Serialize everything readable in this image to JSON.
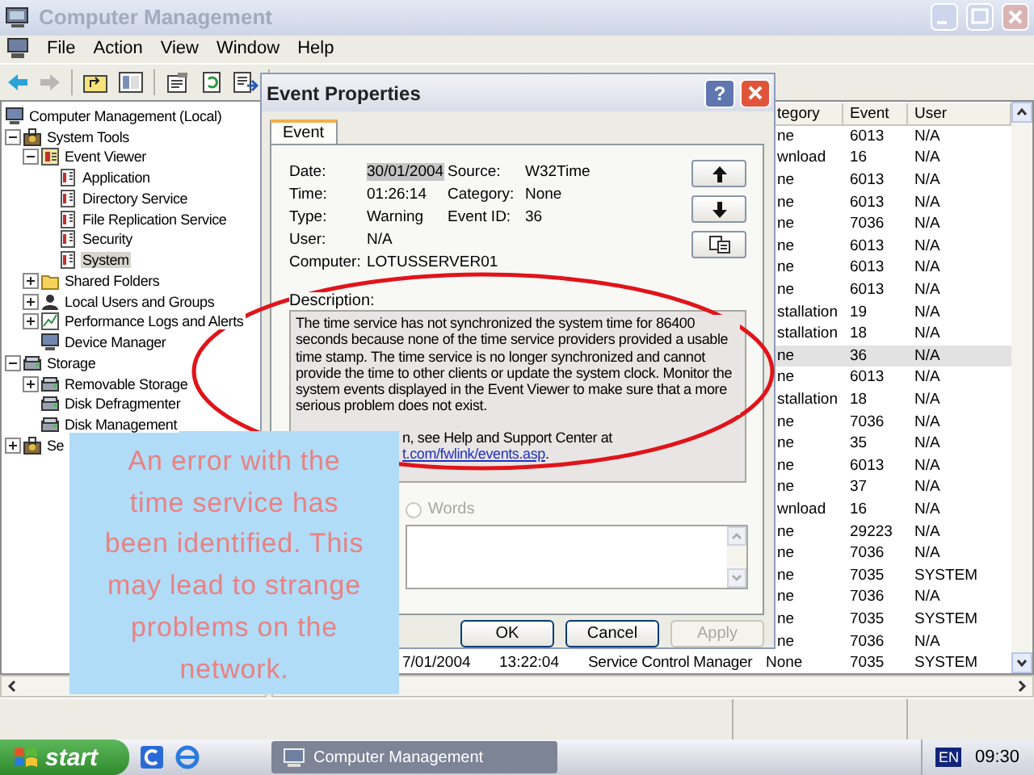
{
  "window": {
    "title": "Computer Management"
  },
  "menu": [
    "File",
    "Action",
    "View",
    "Window",
    "Help"
  ],
  "tree": [
    {
      "label": "Computer Management (Local)",
      "kind": "computer",
      "selected": false,
      "children": [
        {
          "label": "System Tools",
          "kind": "tools",
          "expanded": true,
          "selected": false,
          "children": [
            {
              "label": "Event Viewer",
              "kind": "viewer",
              "expanded": true,
              "selected": false,
              "children": [
                {
                  "label": "Application",
                  "kind": "log",
                  "selected": false
                },
                {
                  "label": "Directory Service",
                  "kind": "log",
                  "selected": false
                },
                {
                  "label": "File Replication Service",
                  "kind": "log",
                  "selected": false
                },
                {
                  "label": "Security",
                  "kind": "log",
                  "selected": false
                },
                {
                  "label": "System",
                  "kind": "log",
                  "selected": true
                }
              ]
            },
            {
              "label": "Shared Folders",
              "kind": "folder",
              "expanded": false,
              "selected": false
            },
            {
              "label": "Local Users and Groups",
              "kind": "users",
              "expanded": false,
              "selected": false
            },
            {
              "label": "Performance Logs and Alerts",
              "kind": "perf",
              "expanded": false,
              "selected": false
            },
            {
              "label": "Device Manager",
              "kind": "computer",
              "selected": false
            }
          ]
        },
        {
          "label": "Storage",
          "kind": "storage",
          "expanded": true,
          "selected": false,
          "children": [
            {
              "label": "Removable Storage",
              "kind": "storage",
              "expanded": false,
              "selected": false
            },
            {
              "label": "Disk Defragmenter",
              "kind": "storage",
              "selected": false
            },
            {
              "label": "Disk Management",
              "kind": "storage",
              "selected": false
            }
          ]
        },
        {
          "label": "Se",
          "kind": "tools",
          "expanded": false,
          "selected": false
        }
      ]
    }
  ],
  "list": {
    "columns": [
      "tegory",
      "Event",
      "User"
    ],
    "rows": [
      {
        "category": "ne",
        "event": "6013",
        "user": "N/A",
        "selected": false
      },
      {
        "category": "wnload",
        "event": "16",
        "user": "N/A",
        "selected": false
      },
      {
        "category": "ne",
        "event": "6013",
        "user": "N/A",
        "selected": false
      },
      {
        "category": "ne",
        "event": "6013",
        "user": "N/A",
        "selected": false
      },
      {
        "category": "ne",
        "event": "7036",
        "user": "N/A",
        "selected": false
      },
      {
        "category": "ne",
        "event": "6013",
        "user": "N/A",
        "selected": false
      },
      {
        "category": "ne",
        "event": "6013",
        "user": "N/A",
        "selected": false
      },
      {
        "category": "ne",
        "event": "6013",
        "user": "N/A",
        "selected": false
      },
      {
        "category": "stallation",
        "event": "19",
        "user": "N/A",
        "selected": false
      },
      {
        "category": "stallation",
        "event": "18",
        "user": "N/A",
        "selected": false
      },
      {
        "category": "ne",
        "event": "36",
        "user": "N/A",
        "selected": true
      },
      {
        "category": "ne",
        "event": "6013",
        "user": "N/A",
        "selected": false
      },
      {
        "category": "stallation",
        "event": "18",
        "user": "N/A",
        "selected": false
      },
      {
        "category": "ne",
        "event": "7036",
        "user": "N/A",
        "selected": false
      },
      {
        "category": "ne",
        "event": "35",
        "user": "N/A",
        "selected": false
      },
      {
        "category": "ne",
        "event": "6013",
        "user": "N/A",
        "selected": false
      },
      {
        "category": "ne",
        "event": "37",
        "user": "N/A",
        "selected": false
      },
      {
        "category": "wnload",
        "event": "16",
        "user": "N/A",
        "selected": false
      },
      {
        "category": "ne",
        "event": "29223",
        "user": "N/A",
        "selected": false
      },
      {
        "category": "ne",
        "event": "7036",
        "user": "N/A",
        "selected": false
      },
      {
        "category": "ne",
        "event": "7035",
        "user": "SYSTEM",
        "selected": false
      },
      {
        "category": "ne",
        "event": "7036",
        "user": "N/A",
        "selected": false
      },
      {
        "category": "ne",
        "event": "7035",
        "user": "SYSTEM",
        "selected": false
      },
      {
        "category": "ne",
        "event": "7036",
        "user": "N/A",
        "selected": false
      },
      {
        "date": "7/01/2004",
        "time": "13:22:04",
        "source": "Service Control Manager",
        "category": "None",
        "event": "7035",
        "user": "SYSTEM",
        "selected": false
      }
    ]
  },
  "dialog": {
    "title": "Event Properties",
    "help_button": "?",
    "tabs": [
      {
        "label": "Event",
        "selected": true
      }
    ],
    "fields": [
      [
        {
          "label": "Date:",
          "value": "30/01/2004",
          "highlighted": true
        },
        {
          "label": "Source:",
          "value": "W32Time",
          "highlighted": false
        }
      ],
      [
        {
          "label": "Time:",
          "value": "01:26:14",
          "highlighted": false
        },
        {
          "label": "Category:",
          "value": "None",
          "highlighted": false
        }
      ],
      [
        {
          "label": "Type:",
          "value": "Warning",
          "highlighted": false
        },
        {
          "label": "Event ID:",
          "value": "36",
          "highlighted": false
        }
      ],
      [
        {
          "label": "User:",
          "value": "N/A",
          "highlighted": false
        }
      ],
      [
        {
          "label": "Computer:",
          "value": "LOTUSSERVER01",
          "highlighted": false
        }
      ]
    ],
    "description_label": "Description:",
    "description": "The time service has not synchronized the system time for 86400 seconds because none of the time service providers provided a usable time stamp. The time service is no longer synchronized and cannot provide the time to other clients or update the system clock. Monitor the system events displayed in the Event Viewer to make sure that a more serious problem does not exist.",
    "more_info": "n, see Help and Support Center at",
    "link": "t.com/fwlink/events.asp",
    "link_end": ".",
    "data_format": {
      "label": "Words",
      "disabled": true
    },
    "buttons": [
      {
        "label": "OK",
        "disabled": false
      },
      {
        "label": "Cancel",
        "disabled": false
      },
      {
        "label": "Apply",
        "disabled": true
      }
    ]
  },
  "callout": {
    "text": "An error with the time service has been identified. This may lead to strange problems on the network."
  },
  "taskbar": {
    "start": "start",
    "tasks": [
      {
        "label": "Computer Management",
        "active": true
      }
    ],
    "language": "EN",
    "clock": "09:30"
  }
}
